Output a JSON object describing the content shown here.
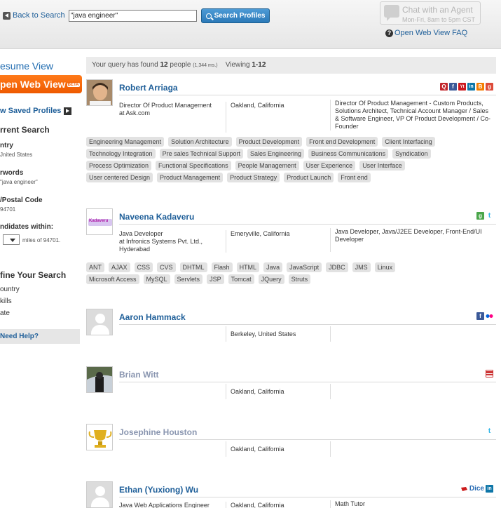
{
  "header": {
    "back_label": "Back to Search",
    "search_value": "\"java engineer\"",
    "search_button": "Search Profiles",
    "chat_title": "Chat with an Agent",
    "chat_hours": "Mon-Fri, 8am to 5pm CST",
    "faq_label": "Open Web View FAQ"
  },
  "sidebar": {
    "resume_view": "esume View",
    "open_web_view": "pen Web View",
    "beta_badge": "BETA",
    "saved_profiles": "w Saved Profiles",
    "current_search": "rrent Search",
    "country_label": "ntry",
    "country_value": "Jnited States",
    "keywords_label": "rwords",
    "keywords_value": "\"java engineer\"",
    "postal_label": "/Postal Code",
    "postal_value": "94701",
    "within_label": "ndidates within:",
    "within_text": "miles of 94701.",
    "refine_title": "fine Your Search",
    "refine_links": [
      "ountry",
      "kills",
      "ate"
    ],
    "need_help": "Need Help?"
  },
  "query": {
    "prefix": "Your query has found",
    "count": "12",
    "people": "people",
    "time": "(1,344 ms.)",
    "viewing_label": "Viewing",
    "viewing_range": "1-12"
  },
  "results": [
    {
      "name": "Robert Arriaga",
      "title": "Director Of Product Management",
      "company": "at Ask.com",
      "location": "Oakland, California",
      "headline": "Director Of Product Management - Custom Products,  Solutions Architect,  Technical Account Manager / Sales & Software Engineer,  VP Of Product Development / Co-Founder",
      "tags": [
        "Engineering Management",
        "Solution Architecture",
        "Product Development",
        "Front end Development",
        "Client Interfacing",
        "Technology Integration",
        "Pre sales Technical Support",
        "Sales Engineering",
        "Business Communications",
        "Syndication",
        "Process Optimization",
        "Functional Specifications",
        "People Management",
        "User Experience",
        "User Interface",
        "User centered Design",
        "Product Management",
        "Product Strategy",
        "Product Launch",
        "Front end"
      ]
    },
    {
      "name": "Naveena Kadaveru",
      "title": "Java Developer",
      "company": "at Infronics Systems Pvt. Ltd., Hyderabad",
      "location": "Emeryville, California",
      "headline": "Java Developer,  Java/J2EE Developer,  Front-End/UI Developer",
      "avatar_text": "Kadaveru",
      "tags": [
        "ANT",
        "AJAX",
        "CSS",
        "CVS",
        "DHTML",
        "Flash",
        "HTML",
        "Java",
        "JavaScript",
        "JDBC",
        "JMS",
        "Linux",
        "Microsoft Access",
        "MySQL",
        "Servlets",
        "JSP",
        "Tomcat",
        "JQuery",
        "Struts"
      ]
    },
    {
      "name": "Aaron Hammack",
      "location": "Berkeley, United States"
    },
    {
      "name": "Brian Witt",
      "location": "Oakland, California"
    },
    {
      "name": "Josephine Houston",
      "location": "Oakland, California"
    },
    {
      "name": "Ethan (Yuxiong) Wu",
      "title": "Java Web Applications Engineer",
      "location": "Oakland, California",
      "headline": "Math Tutor",
      "dice_label": "Dice"
    }
  ],
  "colors": {
    "link_blue": "#1f5f99",
    "accent_orange": "#ee5a00",
    "button_blue": "#2b79b8"
  }
}
